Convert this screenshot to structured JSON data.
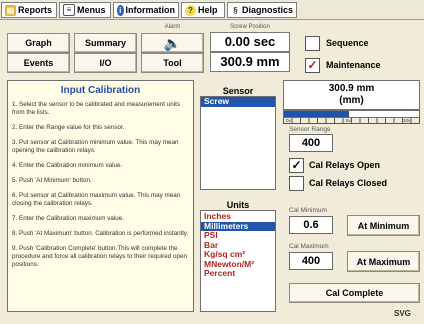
{
  "menubar": {
    "reports": "Reports",
    "menus": "Menus",
    "information": "Information",
    "help": "Help",
    "diagnostics": "Diagnostics"
  },
  "nav": {
    "graph": "Graph",
    "summary": "Summary",
    "events": "Events",
    "io": "I/O",
    "tool": "Tool",
    "alarm_label": "Alarm"
  },
  "screw_position": {
    "label": "Screw Position",
    "time": "0.00 sec",
    "distance": "300.9 mm"
  },
  "options": {
    "sequence": {
      "label": "Sequence",
      "checked": false
    },
    "maintenance": {
      "label": "Maintenance",
      "checked": true
    }
  },
  "input_calibration": {
    "title": "Input Calibration",
    "steps": [
      "1. Select the sensor to be calibrated and measurement units from the lists.",
      "2. Enter the Range value for this sensor.",
      "3. Put sensor at Calibration minimum value. This may mean opening the calibration relays.",
      "4. Enter the Calibration minimum value.",
      "5. Push 'At Minimum' button.",
      "6. Put sensor at Calibration maximum value. This may mean closing the calibration relays.",
      "7. Enter the Calibration maximum value.",
      "8. Push 'At Maximum' button. Calibration is performed instantly.",
      "9. Push 'Calibration Complete' button.This will complete the procedure and force all calibration relays to their required open positions."
    ]
  },
  "sensor": {
    "header": "Sensor",
    "items": [
      "Screw"
    ],
    "selected": "Screw"
  },
  "units": {
    "header": "Units",
    "items": [
      "Inches",
      "Millimeters",
      "PSI",
      "Bar",
      "Kg/sq cm²",
      "MNewton/M²",
      "Percent"
    ],
    "selected": "Millimeters"
  },
  "gauge": {
    "value": "300.9 mm",
    "unit": "(mm)",
    "fill_fraction": 0.48,
    "tick_labels": [
      "0v",
      "5v",
      "10v"
    ]
  },
  "sensor_range": {
    "label": "Sensor Range",
    "value": "400"
  },
  "relays": {
    "open": {
      "label": "Cal Relays Open",
      "checked": true
    },
    "closed": {
      "label": "Cal Relays Closed",
      "checked": false
    }
  },
  "cal_minimum": {
    "label": "Cal Minimum",
    "value": "0.6",
    "button": "At Minimum"
  },
  "cal_maximum": {
    "label": "Cal Maximum",
    "value": "400",
    "button": "At Maximum"
  },
  "cal_complete": {
    "label": "Cal Complete"
  },
  "footer": {
    "text": "SVG"
  },
  "colors": {
    "background": "#f0ecd9",
    "selection": "#2255aa",
    "list_text": "#b3261e",
    "gauge_fill": "#2255aa"
  }
}
